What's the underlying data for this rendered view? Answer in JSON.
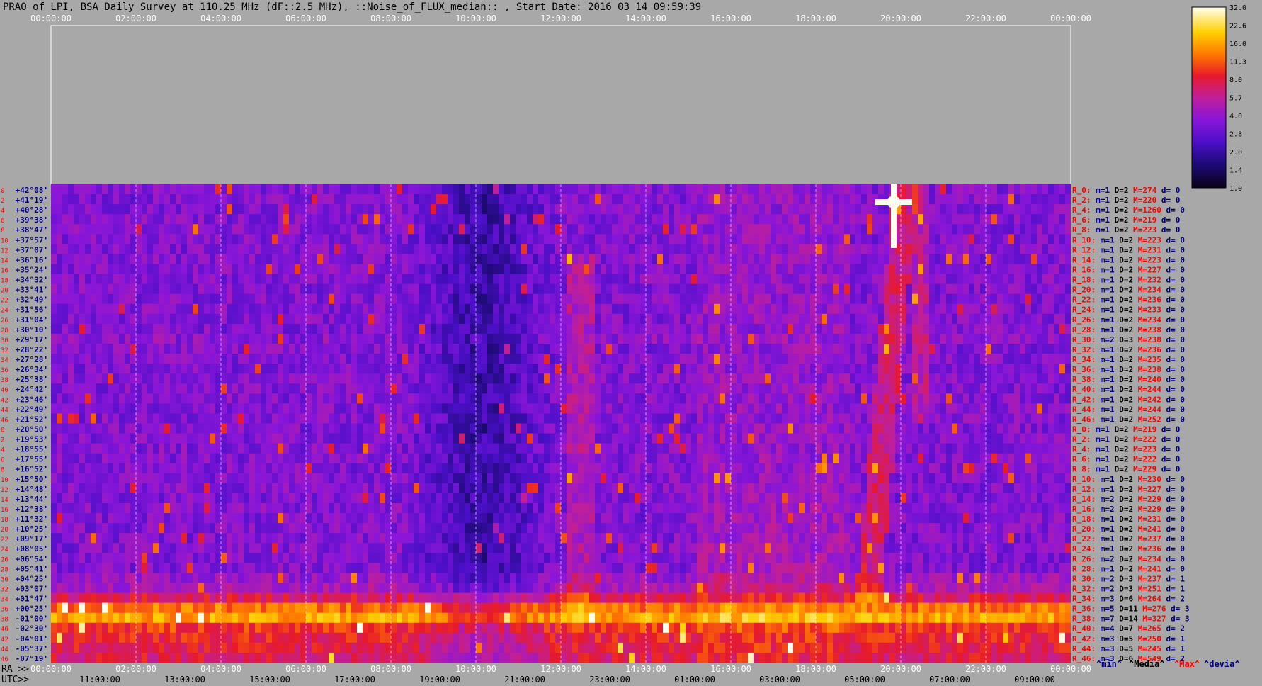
{
  "chart_data": {
    "type": "heatmap",
    "title": "PRAO of LPI, BSA Daily Survey at 110.25 MHz (dF::2.5 MHz), ::Noise_of_FLUX_median:: , Start Date: 2016 03 14 09:59:39",
    "top_time_ticks": [
      "00:00:00",
      "02:00:00",
      "04:00:00",
      "06:00:00",
      "08:00:00",
      "10:00:00",
      "12:00:00",
      "14:00:00",
      "16:00:00",
      "18:00:00",
      "20:00:00",
      "22:00:00",
      "00:00:00"
    ],
    "bottom_ra_axis": {
      "label": "RA >>",
      "ticks": [
        "00:00:00",
        "02:00:00",
        "04:00:00",
        "06:00:00",
        "08:00:00",
        "10:00:00",
        "12:00:00",
        "14:00:00",
        "16:00:00",
        "18:00:00",
        "20:00:00",
        "22:00:00",
        "00:00:00"
      ]
    },
    "bottom_utc_axis": {
      "label": "UTC>>",
      "ticks": [
        "11:00:00",
        "13:00:00",
        "15:00:00",
        "17:00:00",
        "19:00:00",
        "21:00:00",
        "23:00:00",
        "01:00:00",
        "03:00:00",
        "05:00:00",
        "07:00:00",
        "09:00:00"
      ]
    },
    "declinations": [
      "+42°08'",
      "+41°19'",
      "+40°28'",
      "+39°38'",
      "+38°47'",
      "+37°57'",
      "+37°07'",
      "+36°16'",
      "+35°24'",
      "+34°32'",
      "+33°41'",
      "+32°49'",
      "+31°56'",
      "+31°04'",
      "+30°10'",
      "+29°17'",
      "+28°22'",
      "+27°28'",
      "+26°34'",
      "+25°38'",
      "+24°42'",
      "+23°46'",
      "+22°49'",
      "+21°52'",
      "+20°50'",
      "+19°53'",
      "+18°55'",
      "+17°55'",
      "+16°52'",
      "+15°50'",
      "+14°48'",
      "+13°44'",
      "+12°38'",
      "+11°32'",
      "+10°25'",
      "+09°17'",
      "+08°05'",
      "+06°54'",
      "+05°41'",
      "+04°25'",
      "+03°07'",
      "+01°47'",
      "+00°25'",
      "-01°00'",
      "-02°30'",
      "-04°01'",
      "-05°37'",
      "-07°19'"
    ],
    "row_index_labels": [
      "0",
      "2",
      "4",
      "6",
      "8",
      "10",
      "12",
      "14",
      "16",
      "18",
      "20",
      "22",
      "24",
      "26",
      "28",
      "30",
      "32",
      "34",
      "36",
      "38",
      "40",
      "42",
      "44",
      "46",
      "0",
      "2",
      "4",
      "6",
      "8",
      "10",
      "12",
      "14",
      "16",
      "18",
      "20",
      "22",
      "24",
      "26",
      "28",
      "30",
      "32",
      "34",
      "36",
      "38",
      "40",
      "42",
      "44",
      "46"
    ],
    "channel_stats": [
      {
        "ch": "R_0:",
        "min": 1,
        "med": 2,
        "max": 274,
        "dev": 0
      },
      {
        "ch": "R_2:",
        "min": 1,
        "med": 2,
        "max": 220,
        "dev": 0
      },
      {
        "ch": "R_4:",
        "min": 1,
        "med": 2,
        "max": 1260,
        "dev": 0
      },
      {
        "ch": "R_6:",
        "min": 1,
        "med": 2,
        "max": 219,
        "dev": 0
      },
      {
        "ch": "R_8:",
        "min": 1,
        "med": 2,
        "max": 223,
        "dev": 0
      },
      {
        "ch": "R_10:",
        "min": 1,
        "med": 2,
        "max": 223,
        "dev": 0
      },
      {
        "ch": "R_12:",
        "min": 1,
        "med": 2,
        "max": 231,
        "dev": 0
      },
      {
        "ch": "R_14:",
        "min": 1,
        "med": 2,
        "max": 223,
        "dev": 0
      },
      {
        "ch": "R_16:",
        "min": 1,
        "med": 2,
        "max": 227,
        "dev": 0
      },
      {
        "ch": "R_18:",
        "min": 1,
        "med": 2,
        "max": 232,
        "dev": 0
      },
      {
        "ch": "R_20:",
        "min": 1,
        "med": 2,
        "max": 234,
        "dev": 0
      },
      {
        "ch": "R_22:",
        "min": 1,
        "med": 2,
        "max": 236,
        "dev": 0
      },
      {
        "ch": "R_24:",
        "min": 1,
        "med": 2,
        "max": 233,
        "dev": 0
      },
      {
        "ch": "R_26:",
        "min": 1,
        "med": 2,
        "max": 234,
        "dev": 0
      },
      {
        "ch": "R_28:",
        "min": 1,
        "med": 2,
        "max": 238,
        "dev": 0
      },
      {
        "ch": "R_30:",
        "min": 2,
        "med": 3,
        "max": 238,
        "dev": 0
      },
      {
        "ch": "R_32:",
        "min": 1,
        "med": 2,
        "max": 236,
        "dev": 0
      },
      {
        "ch": "R_34:",
        "min": 1,
        "med": 2,
        "max": 235,
        "dev": 0
      },
      {
        "ch": "R_36:",
        "min": 1,
        "med": 2,
        "max": 238,
        "dev": 0
      },
      {
        "ch": "R_38:",
        "min": 1,
        "med": 2,
        "max": 240,
        "dev": 0
      },
      {
        "ch": "R_40:",
        "min": 1,
        "med": 2,
        "max": 244,
        "dev": 0
      },
      {
        "ch": "R_42:",
        "min": 1,
        "med": 2,
        "max": 242,
        "dev": 0
      },
      {
        "ch": "R_44:",
        "min": 1,
        "med": 2,
        "max": 244,
        "dev": 0
      },
      {
        "ch": "R_46:",
        "min": 1,
        "med": 2,
        "max": 252,
        "dev": 0
      },
      {
        "ch": "R_0:",
        "min": 1,
        "med": 2,
        "max": 219,
        "dev": 0
      },
      {
        "ch": "R_2:",
        "min": 1,
        "med": 2,
        "max": 222,
        "dev": 0
      },
      {
        "ch": "R_4:",
        "min": 1,
        "med": 2,
        "max": 223,
        "dev": 0
      },
      {
        "ch": "R_6:",
        "min": 1,
        "med": 2,
        "max": 222,
        "dev": 0
      },
      {
        "ch": "R_8:",
        "min": 1,
        "med": 2,
        "max": 229,
        "dev": 0
      },
      {
        "ch": "R_10:",
        "min": 1,
        "med": 2,
        "max": 230,
        "dev": 0
      },
      {
        "ch": "R_12:",
        "min": 1,
        "med": 2,
        "max": 227,
        "dev": 0
      },
      {
        "ch": "R_14:",
        "min": 2,
        "med": 2,
        "max": 229,
        "dev": 0
      },
      {
        "ch": "R_16:",
        "min": 2,
        "med": 2,
        "max": 229,
        "dev": 0
      },
      {
        "ch": "R_18:",
        "min": 1,
        "med": 2,
        "max": 231,
        "dev": 0
      },
      {
        "ch": "R_20:",
        "min": 1,
        "med": 2,
        "max": 241,
        "dev": 0
      },
      {
        "ch": "R_22:",
        "min": 1,
        "med": 2,
        "max": 237,
        "dev": 0
      },
      {
        "ch": "R_24:",
        "min": 1,
        "med": 2,
        "max": 236,
        "dev": 0
      },
      {
        "ch": "R_26:",
        "min": 2,
        "med": 2,
        "max": 234,
        "dev": 0
      },
      {
        "ch": "R_28:",
        "min": 1,
        "med": 2,
        "max": 241,
        "dev": 0
      },
      {
        "ch": "R_30:",
        "min": 2,
        "med": 3,
        "max": 237,
        "dev": 1
      },
      {
        "ch": "R_32:",
        "min": 2,
        "med": 3,
        "max": 251,
        "dev": 1
      },
      {
        "ch": "R_34:",
        "min": 3,
        "med": 6,
        "max": 264,
        "dev": 2
      },
      {
        "ch": "R_36:",
        "min": 5,
        "med": 11,
        "max": 276,
        "dev": 3
      },
      {
        "ch": "R_38:",
        "min": 7,
        "med": 14,
        "max": 327,
        "dev": 3
      },
      {
        "ch": "R_40:",
        "min": 4,
        "med": 7,
        "max": 265,
        "dev": 2
      },
      {
        "ch": "R_42:",
        "min": 3,
        "med": 5,
        "max": 250,
        "dev": 1
      },
      {
        "ch": "R_44:",
        "min": 3,
        "med": 5,
        "max": 245,
        "dev": 1
      },
      {
        "ch": "R_46:",
        "min": 3,
        "med": 6,
        "max": 549,
        "dev": 2
      }
    ],
    "stats_legend": [
      "^min^",
      "^Media^",
      "^Max^",
      "^devia^"
    ],
    "colorbar": {
      "ticks": [
        "32.0",
        "22.6",
        "16.0",
        "11.3",
        "8.0",
        "5.7",
        "4.0",
        "2.8",
        "2.0",
        "1.4",
        "1.0"
      ],
      "colors": [
        "#0b0018",
        "#1a0a6e",
        "#4b0fc8",
        "#8a16d8",
        "#c01f9a",
        "#e81a2a",
        "#ff7a00",
        "#ffd000",
        "#fffff0"
      ]
    },
    "colors": {
      "background": "#a8a8a8",
      "heat_low": "#3a0a8a",
      "heat_mid": "#8a16d8",
      "heat_high": "#ffd000",
      "label_red": "#ff0000",
      "label_navy": "#000080"
    }
  }
}
